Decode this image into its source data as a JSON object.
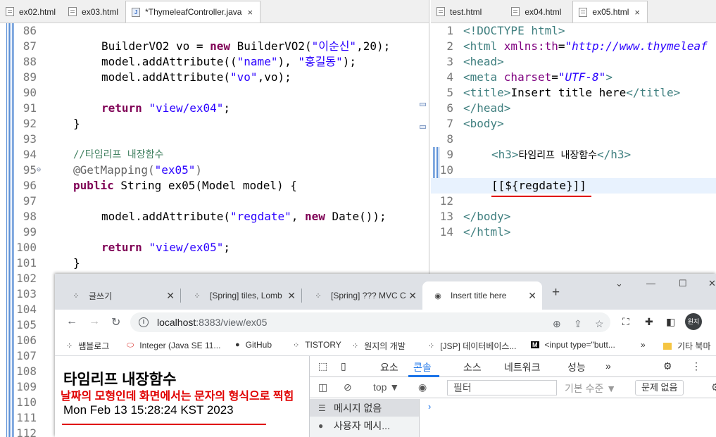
{
  "left_editor": {
    "tabs": [
      {
        "label": "ex02.html",
        "icon": "file-icon",
        "active": false
      },
      {
        "label": "ex03.html",
        "icon": "file-icon",
        "active": false
      },
      {
        "label": "*ThymeleafController.java",
        "icon": "java-file-icon",
        "active": true,
        "close": "×"
      }
    ],
    "lines": [
      "86",
      "87",
      "88",
      "89",
      "90",
      "91",
      "92",
      "93",
      "94",
      "95",
      "96",
      "97",
      "98",
      "99",
      "100",
      "101",
      "102",
      "103",
      "104",
      "105",
      "106",
      "107",
      "108",
      "109",
      "110",
      "111",
      "112"
    ],
    "code": {
      "l87": {
        "a": "BuilderVO2 vo = ",
        "b": "new",
        "c": " BuilderVO2(",
        "d": "\"이순신\"",
        "e": ",20);"
      },
      "l88": {
        "a": "model.addAttribute((",
        "b": "\"name\"",
        "c": "), ",
        "d": "\"홍길동\"",
        "e": ");"
      },
      "l89": {
        "a": "model.addAttribute(",
        "b": "\"vo\"",
        "c": ",vo);"
      },
      "l91": {
        "a": "return",
        "b": " ",
        "c": "\"view/ex04\"",
        "d": ";"
      },
      "l92": "}",
      "l94": "//타임리프 내장함수",
      "l95": {
        "a": "@GetMapping(",
        "b": "\"ex05\"",
        "c": ")"
      },
      "l96": {
        "a": "public",
        "b": " String ex05(Model model) {"
      },
      "l98": {
        "a": "model.addAttribute(",
        "b": "\"regdate\"",
        "c": ", ",
        "d": "new",
        "e": " Date());"
      },
      "l100": {
        "a": "return",
        "b": " ",
        "c": "\"view/ex05\"",
        "d": ";"
      },
      "l101": "}"
    },
    "fold_marker": "⊖"
  },
  "right_editor": {
    "tabs": [
      {
        "label": "test.html",
        "icon": "file-icon",
        "active": false
      },
      {
        "label": "ex04.html",
        "icon": "file-icon",
        "active": false
      },
      {
        "label": "ex05.html",
        "icon": "file-icon",
        "active": true,
        "close": "×"
      }
    ],
    "lines": [
      "1",
      "2",
      "3",
      "4",
      "5",
      "6",
      "7",
      "8",
      "9",
      "10",
      "11",
      "12",
      "13",
      "14"
    ],
    "code": {
      "l1": "<!DOCTYPE html>",
      "l2": {
        "a": "<html ",
        "b": "xmlns:th",
        "c": "=",
        "d": "\"http://www.thymeleaf"
      },
      "l3": "<head>",
      "l4": {
        "a": "<meta ",
        "b": "charset",
        "c": "=",
        "d": "\"UTF-8\"",
        "e": ">"
      },
      "l5": {
        "a": "<title>",
        "b": "Insert title here",
        "c": "</title>"
      },
      "l6": "</head>",
      "l7": "<body>",
      "l9": {
        "a": "<h3>",
        "b": "타임리프 내장함수",
        "c": "</h3>"
      },
      "l11": "[[${regdate}]]",
      "l13": "</body>",
      "l14": "</html>"
    }
  },
  "browser": {
    "tabs": [
      {
        "label": "글쓰기",
        "favicon": "blog-icon"
      },
      {
        "label": "[Spring] tiles, Lomb",
        "favicon": "blog-icon"
      },
      {
        "label": "[Spring] ??? MVC C",
        "favicon": "blog-icon"
      },
      {
        "label": "Insert title here",
        "favicon": "globe-icon",
        "active": true
      }
    ],
    "new_tab": "+",
    "address": {
      "host": "localhost",
      "path": ":8383/view/ex05"
    },
    "bookmarks": [
      {
        "label": "쌤블로그",
        "icon": "blog-icon"
      },
      {
        "label": "Integer (Java SE 11...",
        "icon": "oracle-icon"
      },
      {
        "label": "GitHub",
        "icon": "github-icon"
      },
      {
        "label": "TISTORY",
        "icon": "blog-icon"
      },
      {
        "label": "원지의 개발",
        "icon": "blog-icon"
      },
      {
        "label": "[JSP] 데이터베이스...",
        "icon": "blog-icon"
      },
      {
        "label": "<input type=\"butt...",
        "icon": "mdn-icon"
      }
    ],
    "bookmarks_more": "»",
    "other_bookmarks": "기타 북마",
    "avatar": "원지",
    "page": {
      "heading": "타임리프 내장함수",
      "note": "날짜의 모형인데 화면에서는 문자의 형식으로 찍힘",
      "date": "Mon Feb 13 15:28:24 KST 2023"
    },
    "devtools": {
      "tabs": [
        "요소",
        "콘솔",
        "소스",
        "네트워크",
        "성능"
      ],
      "active_tab": "콘솔",
      "more": "»",
      "context": "top ▼",
      "filter_placeholder": "필터",
      "level": "기본 수준 ▼",
      "issues": "문제 없음",
      "sidebar": [
        "메시지 없음",
        "사용자 메시..."
      ],
      "prompt": "›"
    }
  },
  "colors": {
    "keyword": "#7f0055",
    "string": "#2a00ff",
    "comment": "#3f7f5f",
    "annotation_red": "#e00000",
    "devtools_accent": "#1a73e8"
  }
}
